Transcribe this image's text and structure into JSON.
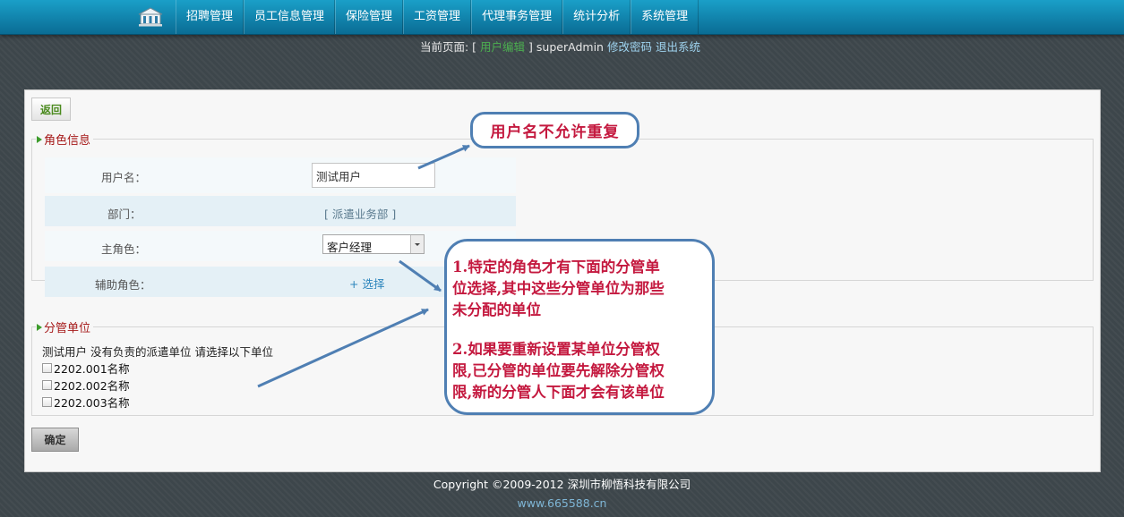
{
  "nav": {
    "home_icon": "home-building-icon",
    "menu": [
      "招聘管理",
      "员工信息管理",
      "保险管理",
      "工资管理",
      "代理事务管理",
      "统计分析",
      "系统管理"
    ]
  },
  "breadcrumb": {
    "prefix": "当前页面: [",
    "current": "用户编辑",
    "suffix": "]",
    "user": "superAdmin",
    "change_password": "修改密码",
    "logout": "退出系统"
  },
  "back_label": "返回",
  "role_section": {
    "legend": "角色信息",
    "username_label": "用户名：",
    "username_value": "测试用户",
    "department_label": "部门：",
    "department_value": "[ 派遣业务部 ]",
    "main_role_label": "主角色：",
    "main_role_value": "客户经理",
    "secondary_role_label": "辅助角色：",
    "select_link": "+ 选择"
  },
  "unit_section": {
    "legend": "分管单位",
    "message": "测试用户 没有负责的派遣单位 请选择以下单位",
    "units": [
      "2202.001名称",
      "2202.002名称",
      "2202.003名称"
    ]
  },
  "confirm_label": "确定",
  "annotations": {
    "note1": "用户名不允许重复",
    "note2_lines": [
      "1.特定的角色才有下面的分管单",
      "位选择,其中这些分管单位为那些",
      "未分配的单位"
    ],
    "note3_lines": [
      "2.如果要重新设置某单位分管权",
      "限,已分管的单位要先解除分管权",
      "限,新的分管人下面才会有该单位"
    ],
    "arrow_color": "#4f7fb3",
    "text_color": "#c4193f"
  },
  "footer": {
    "copyright": "Copyright ©2009-2012 深圳市柳悟科技有限公司",
    "url": "www.665588.cn"
  },
  "colors": {
    "nav_top": "#1a9fc8",
    "nav_bottom": "#0a6c94",
    "background": "#3d464b",
    "legend_text": "#a61a1a"
  }
}
